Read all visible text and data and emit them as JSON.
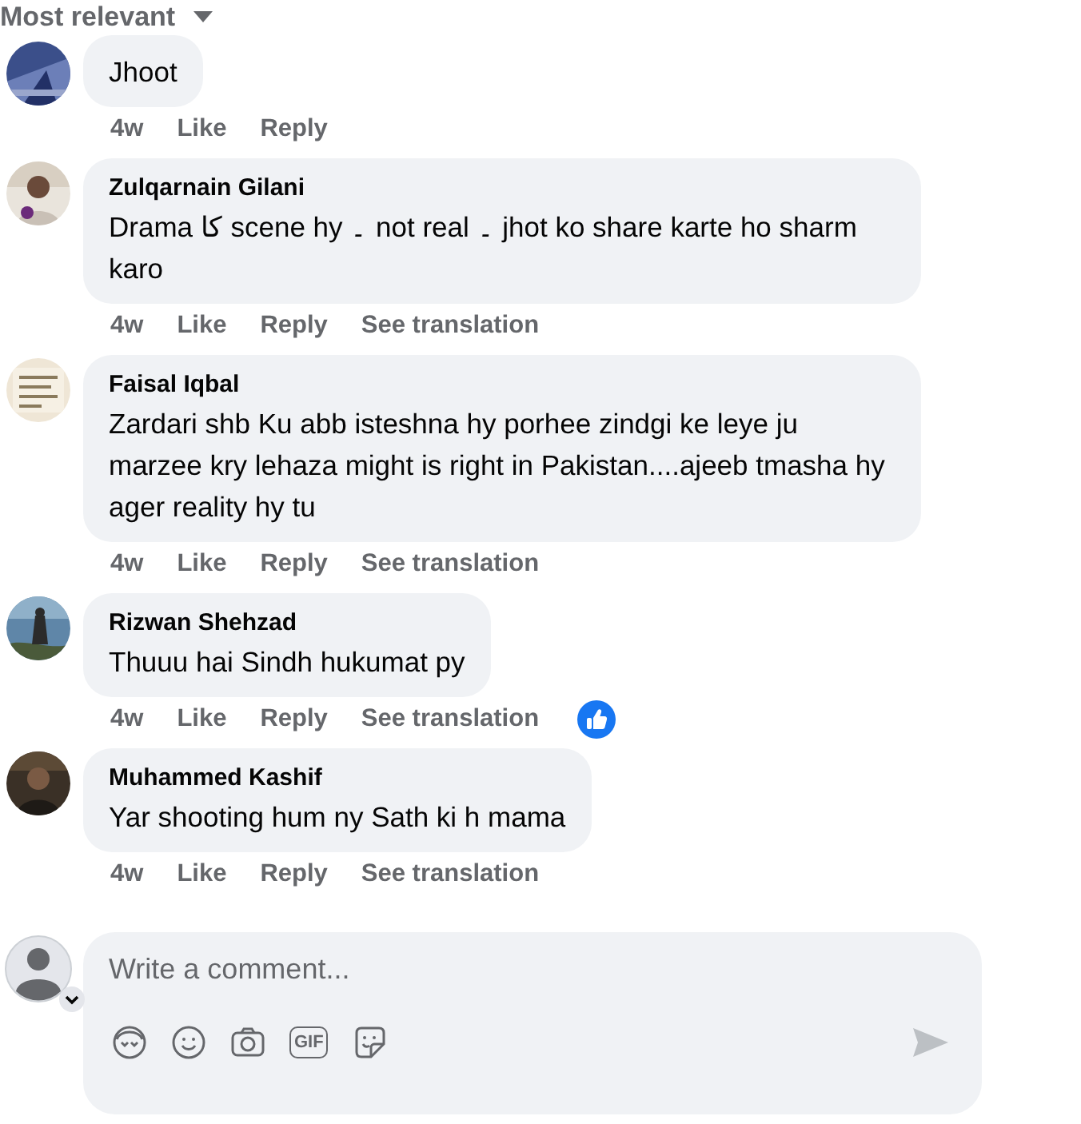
{
  "sort": {
    "label": "Most relevant"
  },
  "comments": [
    {
      "text": "Jhoot",
      "time": "4w",
      "actions": [
        "Like",
        "Reply"
      ]
    },
    {
      "author": "Zulqarnain Gilani",
      "text": "Drama کا scene hy ۔ not real ۔ jhot ko share karte ho sharm karo",
      "time": "4w",
      "actions": [
        "Like",
        "Reply",
        "See translation"
      ]
    },
    {
      "author": "Faisal Iqbal",
      "text": "Zardari shb Ku abb isteshna hy porhee zindgi ke leye ju marzee kry lehaza might is right in Pakistan....ajeeb tmasha hy ager reality hy tu",
      "time": "4w",
      "actions": [
        "Like",
        "Reply",
        "See translation"
      ]
    },
    {
      "author": "Rizwan Shehzad",
      "text": "Thuuu hai Sindh hukumat py",
      "time": "4w",
      "actions": [
        "Like",
        "Reply",
        "See translation"
      ],
      "liked": true
    },
    {
      "author": "Muhammed Kashif",
      "text": "Yar shooting hum ny Sath ki h mama",
      "time": "4w",
      "actions": [
        "Like",
        "Reply",
        "See translation"
      ]
    }
  ],
  "composer": {
    "placeholder": "Write a comment...",
    "gif_label": "GIF",
    "send_enabled": false
  }
}
